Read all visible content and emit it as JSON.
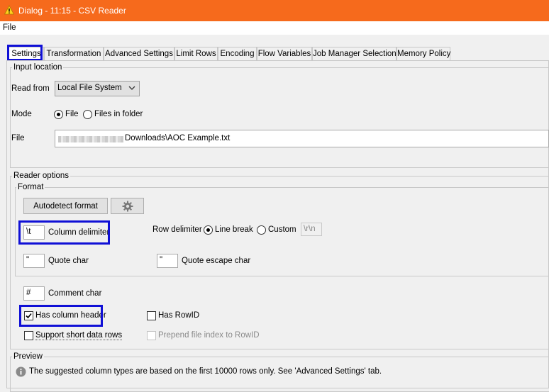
{
  "window": {
    "title": "Dialog - 11:15 - CSV Reader"
  },
  "menu": {
    "file": "File"
  },
  "tabs": [
    "Settings",
    "Transformation",
    "Advanced Settings",
    "Limit Rows",
    "Encoding",
    "Flow Variables",
    "Job Manager Selection",
    "Memory Policy"
  ],
  "input_location": {
    "legend": "Input location",
    "read_from_label": "Read from",
    "read_from_value": "Local File System",
    "mode_label": "Mode",
    "mode_file": "File",
    "mode_files_in_folder": "Files in folder",
    "file_label": "File",
    "file_path_tail": "Downloads\\AOC Example.txt"
  },
  "reader_options": {
    "legend": "Reader options",
    "format_legend": "Format",
    "autodetect_button": "Autodetect format",
    "column_delimiter_value": "\\t",
    "column_delimiter_label": "Column delimiter",
    "row_delimiter_label": "Row delimiter",
    "row_line_break": "Line break",
    "row_custom": "Custom",
    "row_custom_value": "\\r\\n",
    "quote_char_value": "\"",
    "quote_char_label": "Quote char",
    "quote_escape_value": "\"",
    "quote_escape_label": "Quote escape char",
    "comment_char_value": "#",
    "comment_char_label": "Comment char",
    "has_column_header": "Has column header",
    "has_rowid": "Has RowID",
    "support_short_rows": "Support short data rows",
    "prepend_file_index": "Prepend file index to RowID"
  },
  "preview": {
    "legend": "Preview",
    "info": "The suggested column types are based on the first 10000 rows only. See 'Advanced Settings' tab."
  },
  "colors": {
    "titlebar": "#f66a1c",
    "highlight": "#1010d6"
  }
}
